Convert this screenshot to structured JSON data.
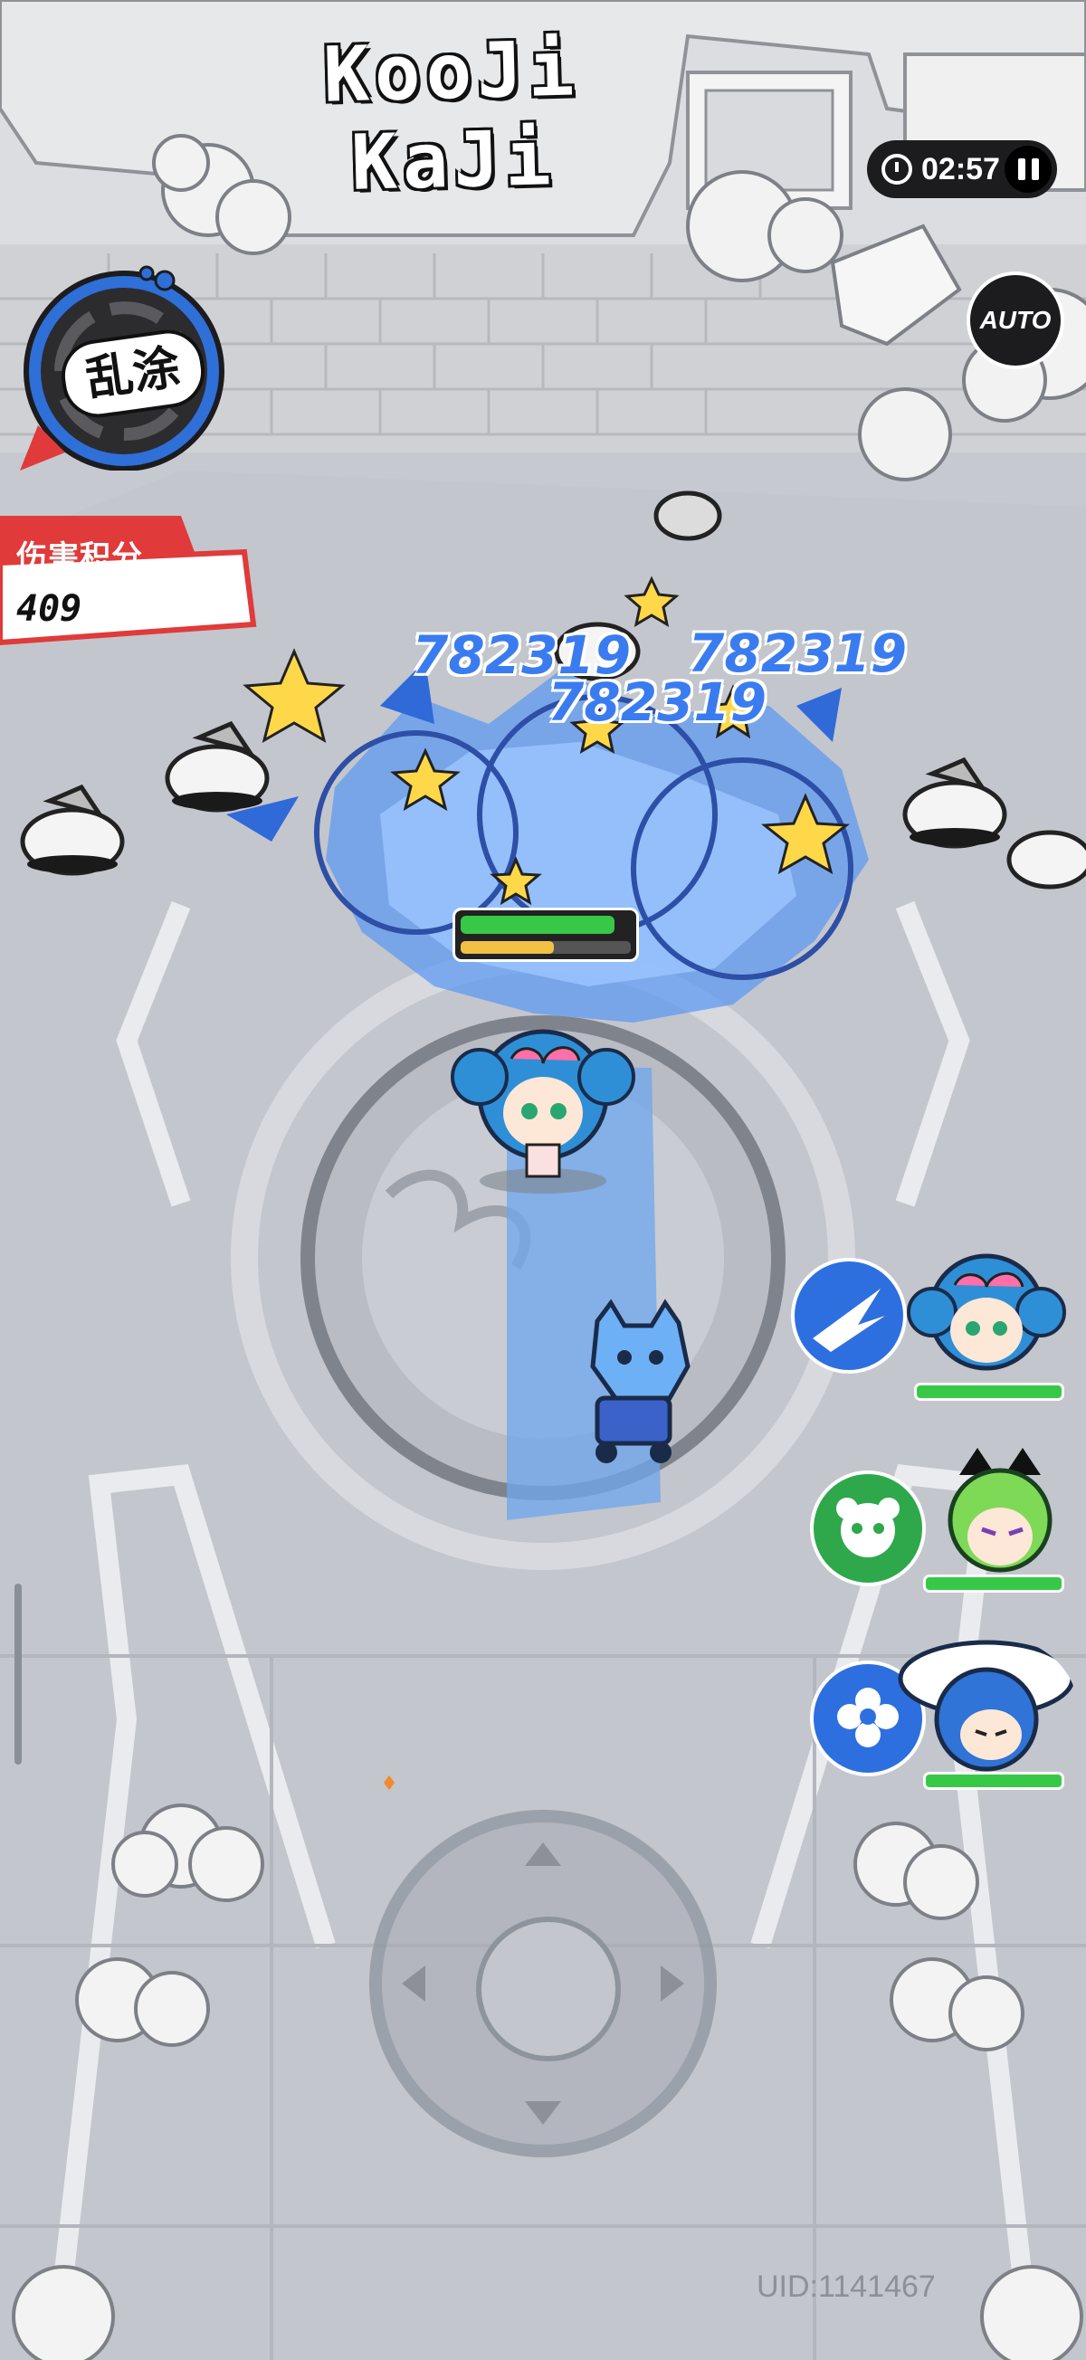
{
  "game": {
    "title": "KooJi KaJi",
    "timer": "02:57",
    "auto_label": "AUTO",
    "skill_label": "乱涂",
    "damage_score_label": "伤害积分",
    "damage_score_value": "409",
    "damage_numbers": [
      "782319",
      "782319",
      "782319"
    ],
    "boss_hp_fraction": 0.9,
    "boss_energy_fraction": 0.55,
    "party": [
      {
        "skill_icon": "ice-slash-icon",
        "hp_fraction": 1.0,
        "accent": "#2e6fe0"
      },
      {
        "skill_icon": "panda-icon",
        "hp_fraction": 1.0,
        "accent": "#2ea84a"
      },
      {
        "skill_icon": "flower-icon",
        "hp_fraction": 1.0,
        "accent": "#2e6fe0"
      }
    ],
    "uid_text": "UID:1141467"
  },
  "colors": {
    "accent_blue": "#3a7cf0",
    "hp_green": "#38c847",
    "energy_yellow": "#f3c046",
    "score_red": "#e03a3a",
    "star_yellow": "#ffd84a"
  }
}
